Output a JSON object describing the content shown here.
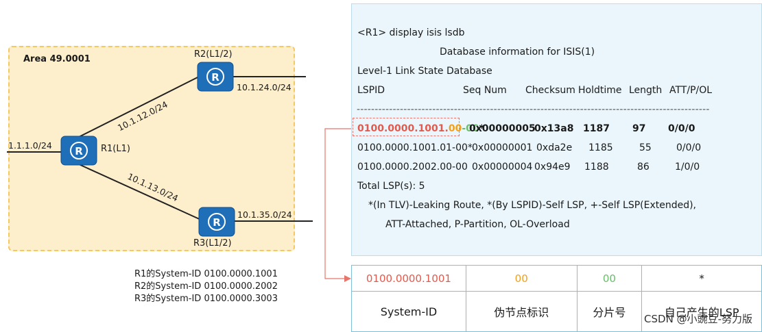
{
  "topology": {
    "area_label": "Area 49.0001",
    "routers": [
      {
        "id": "r1",
        "label": "R1(L1)"
      },
      {
        "id": "r2",
        "label": "R2(L1/2)"
      },
      {
        "id": "r3",
        "label": "R3(L1/2)"
      }
    ],
    "networks": {
      "r1_external": "1.1.1.0/24",
      "r2_external": "10.1.24.0/24",
      "r3_external": "10.1.35.0/24",
      "r1_r2": "10.1.12.0/24",
      "r1_r3": "10.1.13.0/24"
    },
    "system_ids": [
      "R1的System-ID 0100.0000.1001",
      "R2的System-ID 0100.0000.2002",
      "R3的System-ID 0100.0000.3003"
    ]
  },
  "console": {
    "command": "<R1> display isis lsdb",
    "title": "Database information for ISIS(1)",
    "level": "Level-1 Link State Database",
    "headers": [
      "LSPID",
      "Seq Num",
      "Checksum",
      "Holdtime",
      "Length",
      "ATT/P/OL"
    ],
    "separator": "--------------------------------------------------------------------------------------------------",
    "highlight_lspid": {
      "system_id": "0100.0000.1001",
      "dot1": ".",
      "pseudo": "00",
      "dash": "-",
      "frag": "00",
      "self": "*"
    },
    "rows": [
      {
        "lspid": "",
        "seq": "0x00000005",
        "checksum": "0x13a8",
        "holdtime": "1187",
        "length": "97",
        "att": "0/0/0"
      },
      {
        "lspid": "0100.0000.1001.01-00*",
        "seq": "0x00000001",
        "checksum": "0xda2e",
        "holdtime": "1185",
        "length": "55",
        "att": "0/0/0"
      },
      {
        "lspid": "0100.0000.2002.00-00",
        "seq": "0x00000004",
        "checksum": "0x94e9",
        "holdtime": "1188",
        "length": "86",
        "att": "1/0/0"
      }
    ],
    "total": "Total LSP(s): 5",
    "legend1": "*(In TLV)-Leaking Route, *(By LSPID)-Self LSP, +-Self LSP(Extended),",
    "legend2": "ATT-Attached, P-Partition, OL-Overload"
  },
  "breakdown": {
    "values": [
      "0100.0000.1001",
      "00",
      "00",
      "*"
    ],
    "labels": [
      "System-ID",
      "伪节点标识",
      "分片号",
      "自己产生的LSP"
    ]
  },
  "watermark": "CSDN @小豌豆-努力版",
  "colors": {
    "red": "#e15a4d",
    "orange": "#f0a020",
    "green": "#6dbb6d",
    "router": "#1f6fb8",
    "area_fill": "#fdeecc"
  }
}
